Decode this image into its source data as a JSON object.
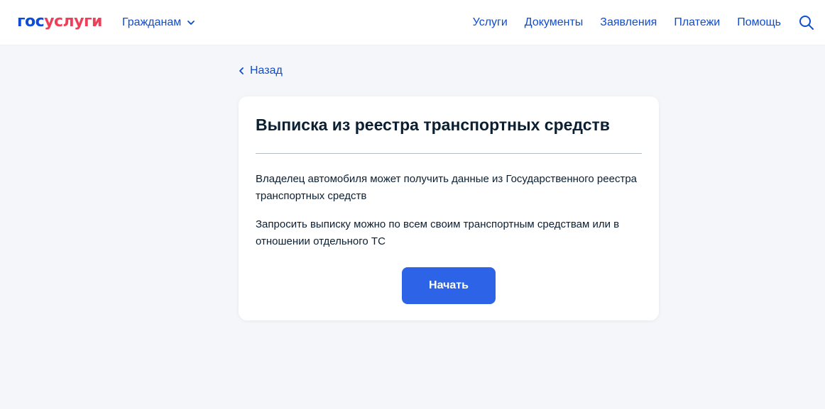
{
  "header": {
    "logo": {
      "part1": "гос",
      "part2": "услуги"
    },
    "audience_label": "Гражданам",
    "nav": [
      "Услуги",
      "Документы",
      "Заявления",
      "Платежи",
      "Помощь"
    ]
  },
  "back_label": "Назад",
  "card": {
    "title": "Выписка из реестра транспортных средств",
    "paragraphs": [
      "Владелец автомобиля может получить данные из Государственного реестра транспортных средств",
      "Запросить выписку можно по всем своим транспортным средствам или в отношении отдельного ТС"
    ],
    "button_label": "Начать"
  },
  "colors": {
    "link": "#0d4cd3",
    "brand_red": "#ee3f58",
    "primary_button": "#2d63e6",
    "background": "#f5f6fa"
  }
}
